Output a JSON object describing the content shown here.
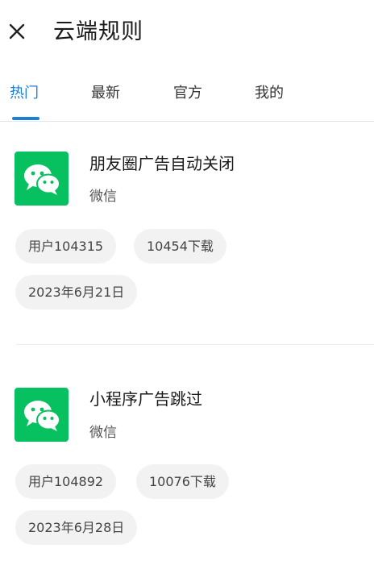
{
  "header": {
    "title": "云端规则",
    "close_icon": "close-icon"
  },
  "tabs": [
    {
      "label": "热门",
      "active": true
    },
    {
      "label": "最新",
      "active": false
    },
    {
      "label": "官方",
      "active": false
    },
    {
      "label": "我的",
      "active": false
    }
  ],
  "colors": {
    "accent": "#1e7fd6",
    "wechat_green": "#07c160",
    "chip_bg": "#f2f2f2"
  },
  "rules": [
    {
      "name": "朋友圈广告自动关闭",
      "app": "微信",
      "icon": "wechat-icon",
      "author": "用户104315",
      "downloads": "10454下载",
      "date": "2023年6月21日"
    },
    {
      "name": "小程序广告跳过",
      "app": "微信",
      "icon": "wechat-icon",
      "author": "用户104892",
      "downloads": "10076下载",
      "date": "2023年6月28日"
    }
  ]
}
